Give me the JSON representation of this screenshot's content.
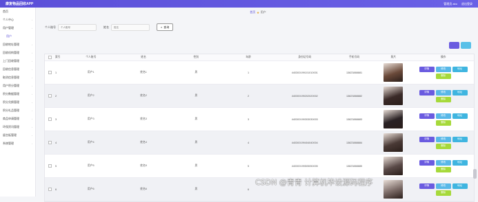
{
  "app": {
    "title": "康复物品回收APP",
    "user_label": "管理员 abo",
    "logout": "退出登录"
  },
  "sidebar": {
    "items": [
      {
        "label": "首页"
      },
      {
        "label": "个人中心"
      },
      {
        "label": "用户管理"
      },
      {
        "label": "用户",
        "sub": true
      },
      {
        "label": "回收地址管理"
      },
      {
        "label": "回收机构管理"
      },
      {
        "label": "上门回收管理"
      },
      {
        "label": "回收信息管理"
      },
      {
        "label": "取消信息管理"
      },
      {
        "label": "用户积分管理"
      },
      {
        "label": "积分数据管理"
      },
      {
        "label": "积分兑换管理"
      },
      {
        "label": "积分礼品管理"
      },
      {
        "label": "商品申请管理"
      },
      {
        "label": "环保资讯管理"
      },
      {
        "label": "留言板管理"
      },
      {
        "label": "系统管理"
      }
    ]
  },
  "breadcrumb": {
    "home": "首页",
    "current": "用户"
  },
  "search": {
    "account_label": "个人账号",
    "account_placeholder": "个人账号",
    "name_label": "姓名",
    "name_placeholder": "姓名",
    "button": "查询"
  },
  "table": {
    "headers": {
      "index": "索引",
      "account": "个人账号",
      "name": "姓名",
      "sex": "性别",
      "age": "年龄",
      "idcard": "身份证号码",
      "phone": "手机号码",
      "photo": "照片",
      "ops": "操作"
    },
    "ops": {
      "view": "详情",
      "edit": "修改",
      "address": "地址",
      "delete": "删除"
    },
    "rows": [
      {
        "index": "1",
        "account": "用户1",
        "name": "姓名1",
        "sex": "男",
        "age": "1",
        "idcard": "440300199101010001",
        "phone": "13823888881",
        "photo_color": "#6b4a3a"
      },
      {
        "index": "2",
        "account": "用户2",
        "name": "姓名2",
        "sex": "男",
        "age": "2",
        "idcard": "440300199202020002",
        "phone": "13823888882",
        "photo_color": "#3a2a28"
      },
      {
        "index": "3",
        "account": "用户3",
        "name": "姓名3",
        "sex": "男",
        "age": "3",
        "idcard": "440300199303030003",
        "phone": "13823888883",
        "photo_color": "#2a2224"
      },
      {
        "index": "4",
        "account": "用户4",
        "name": "姓名4",
        "sex": "男",
        "age": "4",
        "idcard": "440300199404040004",
        "phone": "13823888884",
        "photo_color": "#4a3a36"
      },
      {
        "index": "5",
        "account": "用户5",
        "name": "姓名5",
        "sex": "男",
        "age": "5",
        "idcard": "440300199505050005",
        "phone": "13823888885",
        "photo_color": "#5a4a48"
      },
      {
        "index": "6",
        "account": "用户6",
        "name": "姓名6",
        "sex": "男",
        "age": "6",
        "idcard": "",
        "phone": "",
        "photo_color": "#7a6a66"
      }
    ]
  },
  "watermark": "CSDN @青青  计算机毕设源码程序"
}
